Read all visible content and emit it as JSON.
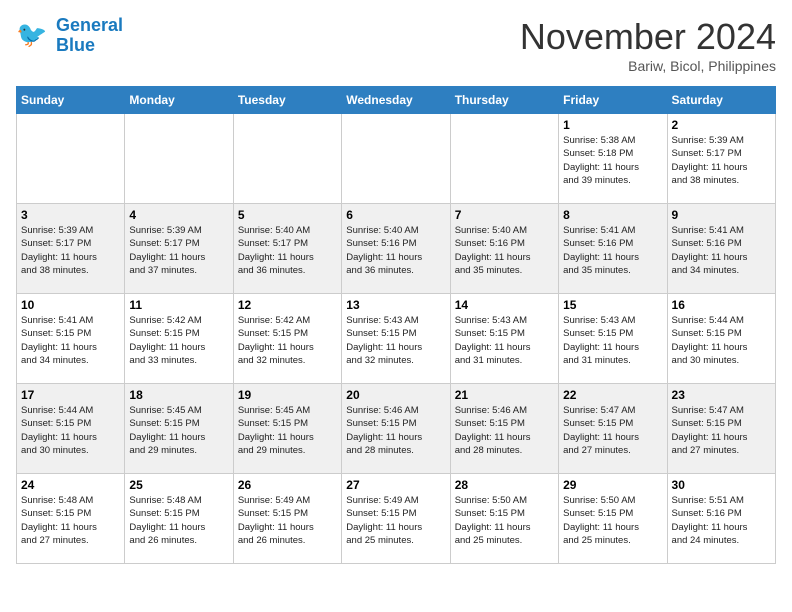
{
  "header": {
    "logo_line1": "General",
    "logo_line2": "Blue",
    "month": "November 2024",
    "location": "Bariw, Bicol, Philippines"
  },
  "weekdays": [
    "Sunday",
    "Monday",
    "Tuesday",
    "Wednesday",
    "Thursday",
    "Friday",
    "Saturday"
  ],
  "weeks": [
    [
      {
        "day": "",
        "info": ""
      },
      {
        "day": "",
        "info": ""
      },
      {
        "day": "",
        "info": ""
      },
      {
        "day": "",
        "info": ""
      },
      {
        "day": "",
        "info": ""
      },
      {
        "day": "1",
        "info": "Sunrise: 5:38 AM\nSunset: 5:18 PM\nDaylight: 11 hours\nand 39 minutes."
      },
      {
        "day": "2",
        "info": "Sunrise: 5:39 AM\nSunset: 5:17 PM\nDaylight: 11 hours\nand 38 minutes."
      }
    ],
    [
      {
        "day": "3",
        "info": "Sunrise: 5:39 AM\nSunset: 5:17 PM\nDaylight: 11 hours\nand 38 minutes."
      },
      {
        "day": "4",
        "info": "Sunrise: 5:39 AM\nSunset: 5:17 PM\nDaylight: 11 hours\nand 37 minutes."
      },
      {
        "day": "5",
        "info": "Sunrise: 5:40 AM\nSunset: 5:17 PM\nDaylight: 11 hours\nand 36 minutes."
      },
      {
        "day": "6",
        "info": "Sunrise: 5:40 AM\nSunset: 5:16 PM\nDaylight: 11 hours\nand 36 minutes."
      },
      {
        "day": "7",
        "info": "Sunrise: 5:40 AM\nSunset: 5:16 PM\nDaylight: 11 hours\nand 35 minutes."
      },
      {
        "day": "8",
        "info": "Sunrise: 5:41 AM\nSunset: 5:16 PM\nDaylight: 11 hours\nand 35 minutes."
      },
      {
        "day": "9",
        "info": "Sunrise: 5:41 AM\nSunset: 5:16 PM\nDaylight: 11 hours\nand 34 minutes."
      }
    ],
    [
      {
        "day": "10",
        "info": "Sunrise: 5:41 AM\nSunset: 5:15 PM\nDaylight: 11 hours\nand 34 minutes."
      },
      {
        "day": "11",
        "info": "Sunrise: 5:42 AM\nSunset: 5:15 PM\nDaylight: 11 hours\nand 33 minutes."
      },
      {
        "day": "12",
        "info": "Sunrise: 5:42 AM\nSunset: 5:15 PM\nDaylight: 11 hours\nand 32 minutes."
      },
      {
        "day": "13",
        "info": "Sunrise: 5:43 AM\nSunset: 5:15 PM\nDaylight: 11 hours\nand 32 minutes."
      },
      {
        "day": "14",
        "info": "Sunrise: 5:43 AM\nSunset: 5:15 PM\nDaylight: 11 hours\nand 31 minutes."
      },
      {
        "day": "15",
        "info": "Sunrise: 5:43 AM\nSunset: 5:15 PM\nDaylight: 11 hours\nand 31 minutes."
      },
      {
        "day": "16",
        "info": "Sunrise: 5:44 AM\nSunset: 5:15 PM\nDaylight: 11 hours\nand 30 minutes."
      }
    ],
    [
      {
        "day": "17",
        "info": "Sunrise: 5:44 AM\nSunset: 5:15 PM\nDaylight: 11 hours\nand 30 minutes."
      },
      {
        "day": "18",
        "info": "Sunrise: 5:45 AM\nSunset: 5:15 PM\nDaylight: 11 hours\nand 29 minutes."
      },
      {
        "day": "19",
        "info": "Sunrise: 5:45 AM\nSunset: 5:15 PM\nDaylight: 11 hours\nand 29 minutes."
      },
      {
        "day": "20",
        "info": "Sunrise: 5:46 AM\nSunset: 5:15 PM\nDaylight: 11 hours\nand 28 minutes."
      },
      {
        "day": "21",
        "info": "Sunrise: 5:46 AM\nSunset: 5:15 PM\nDaylight: 11 hours\nand 28 minutes."
      },
      {
        "day": "22",
        "info": "Sunrise: 5:47 AM\nSunset: 5:15 PM\nDaylight: 11 hours\nand 27 minutes."
      },
      {
        "day": "23",
        "info": "Sunrise: 5:47 AM\nSunset: 5:15 PM\nDaylight: 11 hours\nand 27 minutes."
      }
    ],
    [
      {
        "day": "24",
        "info": "Sunrise: 5:48 AM\nSunset: 5:15 PM\nDaylight: 11 hours\nand 27 minutes."
      },
      {
        "day": "25",
        "info": "Sunrise: 5:48 AM\nSunset: 5:15 PM\nDaylight: 11 hours\nand 26 minutes."
      },
      {
        "day": "26",
        "info": "Sunrise: 5:49 AM\nSunset: 5:15 PM\nDaylight: 11 hours\nand 26 minutes."
      },
      {
        "day": "27",
        "info": "Sunrise: 5:49 AM\nSunset: 5:15 PM\nDaylight: 11 hours\nand 25 minutes."
      },
      {
        "day": "28",
        "info": "Sunrise: 5:50 AM\nSunset: 5:15 PM\nDaylight: 11 hours\nand 25 minutes."
      },
      {
        "day": "29",
        "info": "Sunrise: 5:50 AM\nSunset: 5:15 PM\nDaylight: 11 hours\nand 25 minutes."
      },
      {
        "day": "30",
        "info": "Sunrise: 5:51 AM\nSunset: 5:16 PM\nDaylight: 11 hours\nand 24 minutes."
      }
    ]
  ]
}
